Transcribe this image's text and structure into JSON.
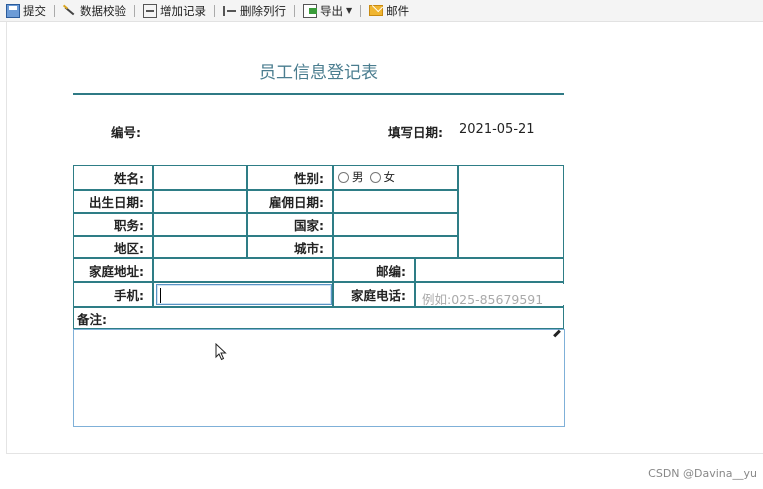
{
  "toolbar": {
    "submit": "提交",
    "validate": "数据校验",
    "add_record": "增加记录",
    "delete_row": "删除列行",
    "export": "导出",
    "mail": "邮件"
  },
  "form": {
    "title": "员工信息登记表",
    "number_label": "编号:",
    "date_label": "填写日期:",
    "date_value": "2021-05-21"
  },
  "fields": {
    "name": "姓名:",
    "gender": "性别:",
    "male": "男",
    "female": "女",
    "birth_date": "出生日期:",
    "hire_date": "雇佣日期:",
    "position": "职务:",
    "country": "国家:",
    "region": "地区:",
    "city": "城市:",
    "home_address": "家庭地址:",
    "postcode": "邮编:",
    "mobile": "手机:",
    "home_phone": "家庭电话:",
    "home_phone_placeholder": "例如:025-85679591",
    "remarks": "备注:"
  },
  "watermark": "CSDN @Davina__yu"
}
